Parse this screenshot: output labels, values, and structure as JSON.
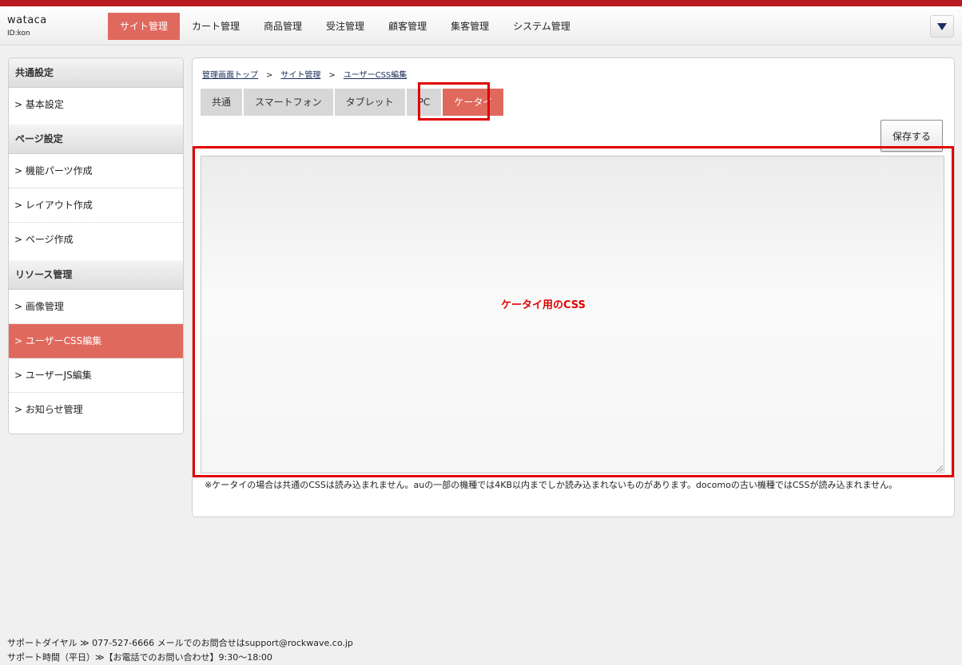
{
  "brand": {
    "name": "wataca",
    "user_id": "ID:kon"
  },
  "nav": {
    "items": [
      "サイト管理",
      "カート管理",
      "商品管理",
      "受注管理",
      "顧客管理",
      "集客管理",
      "システム管理"
    ],
    "active": "サイト管理"
  },
  "sidebar": {
    "sections": [
      {
        "title": "共通設定",
        "items": [
          "> 基本設定"
        ]
      },
      {
        "title": "ページ設定",
        "items": [
          "> 機能パーツ作成",
          "> レイアウト作成",
          "> ページ作成"
        ]
      },
      {
        "title": "リソース管理",
        "items": [
          "> 画像管理",
          "> ユーザーCSS編集",
          "> ユーザーJS編集",
          "> お知らせ管理"
        ]
      }
    ],
    "active_item": "> ユーザーCSS編集"
  },
  "breadcrumb": {
    "items": [
      "管理画面トップ",
      "サイト管理",
      "ユーザーCSS編集"
    ],
    "separator": ">"
  },
  "tabs": {
    "items": [
      "共通",
      "スマートフォン",
      "タブレット",
      "PC",
      "ケータイ"
    ],
    "active": "ケータイ"
  },
  "toolbar": {
    "save_label": "保存する"
  },
  "editor": {
    "annotation": "ケータイ用のCSS",
    "value": ""
  },
  "note": "※ケータイの場合は共通のCSSは読み込まれません。auの一部の機種では4KB以内までしか読み込まれないものがあります。docomoの古い機種ではCSSが読み込まれません。",
  "footer": {
    "line1": "サポートダイヤル ≫ 077-527-6666  メールでのお問合せはsupport@rockwave.co.jp",
    "line2": "サポート時間（平日）≫【お電話でのお問い合わせ】9:30～18:00"
  },
  "colors": {
    "accent": "#e0695e",
    "topbar": "#b81c22",
    "highlight": "#e00000"
  }
}
